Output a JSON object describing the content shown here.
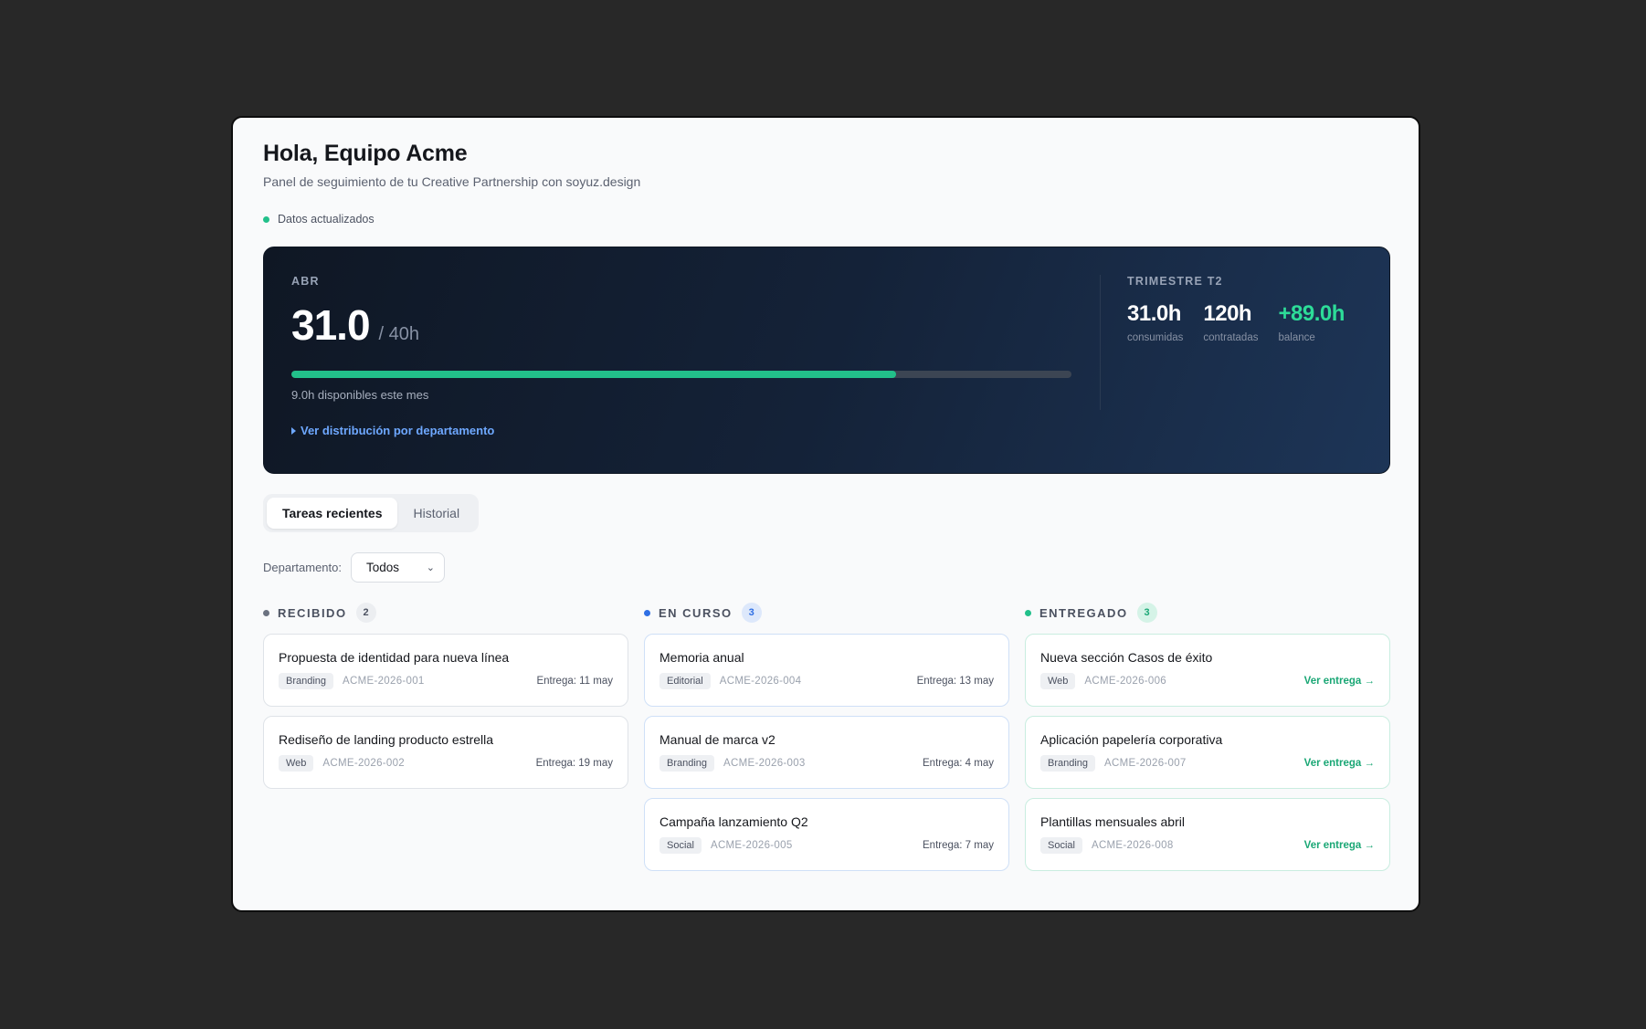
{
  "header": {
    "title": "Hola, Equipo Acme",
    "subtitle": "Panel de seguimiento de tu Creative Partnership con soyuz.design",
    "status": "Datos actualizados"
  },
  "month": {
    "label": "ABR",
    "used": "31.0",
    "total": "/ 40h",
    "progress": 0.775,
    "available": "9.0h disponibles este mes",
    "link": "Ver distribución por departamento"
  },
  "quarter": {
    "label": "TRIMESTRE T2",
    "consumed_value": "31.0h",
    "consumed_label": "consumidas",
    "contracted_value": "120h",
    "contracted_label": "contratadas",
    "balance_value": "+89.0h",
    "balance_label": "balance"
  },
  "tabs": [
    {
      "label": "Tareas recientes",
      "active": true
    },
    {
      "label": "Historial",
      "active": false
    }
  ],
  "filter": {
    "label": "Departamento:",
    "value": "Todos"
  },
  "columns": [
    {
      "title": "RECIBIDO",
      "count": "2",
      "color": "#6b7280",
      "cards": [
        {
          "title": "Propuesta de identidad para nueva línea",
          "tag": "Branding",
          "code": "ACME-2026-001",
          "due": "Entrega: 11 may"
        },
        {
          "title": "Rediseño de landing producto estrella",
          "tag": "Web",
          "code": "ACME-2026-002",
          "due": "Entrega: 19 may"
        }
      ]
    },
    {
      "title": "EN CURSO",
      "count": "3",
      "color": "#2f6fe4",
      "cards": [
        {
          "title": "Memoria anual",
          "tag": "Editorial",
          "code": "ACME-2026-004",
          "due": "Entrega: 13 may"
        },
        {
          "title": "Manual de marca v2",
          "tag": "Branding",
          "code": "ACME-2026-003",
          "due": "Entrega: 4 may"
        },
        {
          "title": "Campaña lanzamiento Q2",
          "tag": "Social",
          "code": "ACME-2026-005",
          "due": "Entrega: 7 may"
        }
      ]
    },
    {
      "title": "ENTREGADO",
      "count": "3",
      "color": "#22c08a",
      "cards": [
        {
          "title": "Nueva sección Casos de éxito",
          "tag": "Web",
          "code": "ACME-2026-006",
          "action": "Ver entrega →"
        },
        {
          "title": "Aplicación papelería corporativa",
          "tag": "Branding",
          "code": "ACME-2026-007",
          "action": "Ver entrega →"
        },
        {
          "title": "Plantillas mensuales abril",
          "tag": "Social",
          "code": "ACME-2026-008",
          "action": "Ver entrega →"
        }
      ]
    }
  ]
}
